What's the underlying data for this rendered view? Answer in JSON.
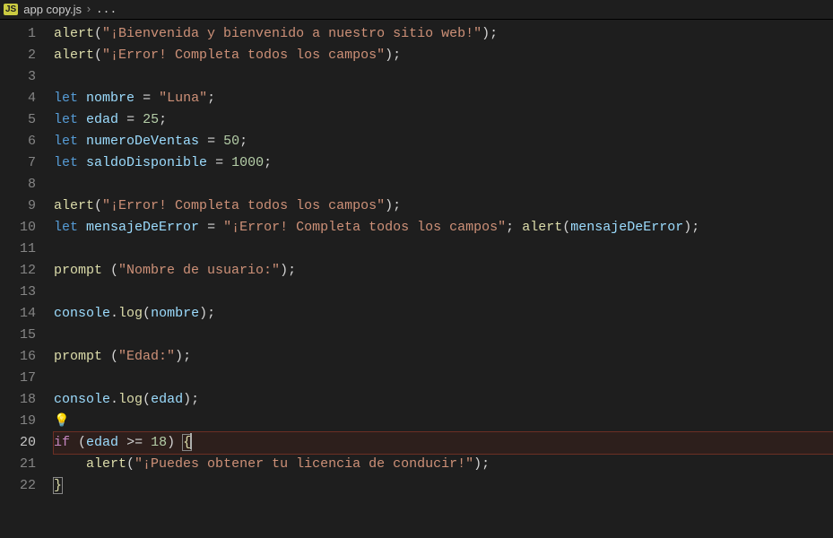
{
  "tab": {
    "icon_label": "JS",
    "filename": "app copy.js",
    "breadcrumb_tail": "..."
  },
  "editor": {
    "active_line": 20,
    "lightbulb_line": 19,
    "highlighted_line": 20,
    "lines": [
      {
        "n": 1,
        "tokens": [
          [
            "fn",
            "alert"
          ],
          [
            "punc",
            "("
          ],
          [
            "str",
            "\"¡Bienvenida y bienvenido a nuestro sitio web!\""
          ],
          [
            "punc",
            ")"
          ],
          [
            "punc",
            ";"
          ]
        ]
      },
      {
        "n": 2,
        "tokens": [
          [
            "fn",
            "alert"
          ],
          [
            "punc",
            "("
          ],
          [
            "str",
            "\"¡Error! Completa todos los campos\""
          ],
          [
            "punc",
            ")"
          ],
          [
            "punc",
            ";"
          ]
        ]
      },
      {
        "n": 3,
        "tokens": []
      },
      {
        "n": 4,
        "tokens": [
          [
            "kw",
            "let"
          ],
          [
            "punc",
            " "
          ],
          [
            "var",
            "nombre"
          ],
          [
            "punc",
            " "
          ],
          [
            "op",
            "="
          ],
          [
            "punc",
            " "
          ],
          [
            "str",
            "\"Luna\""
          ],
          [
            "punc",
            ";"
          ]
        ]
      },
      {
        "n": 5,
        "tokens": [
          [
            "kw",
            "let"
          ],
          [
            "punc",
            " "
          ],
          [
            "var",
            "edad"
          ],
          [
            "punc",
            " "
          ],
          [
            "op",
            "="
          ],
          [
            "punc",
            " "
          ],
          [
            "num",
            "25"
          ],
          [
            "punc",
            ";"
          ]
        ]
      },
      {
        "n": 6,
        "tokens": [
          [
            "kw",
            "let"
          ],
          [
            "punc",
            " "
          ],
          [
            "var",
            "numeroDeVentas"
          ],
          [
            "punc",
            " "
          ],
          [
            "op",
            "="
          ],
          [
            "punc",
            " "
          ],
          [
            "num",
            "50"
          ],
          [
            "punc",
            ";"
          ]
        ]
      },
      {
        "n": 7,
        "tokens": [
          [
            "kw",
            "let"
          ],
          [
            "punc",
            " "
          ],
          [
            "var",
            "saldoDisponible"
          ],
          [
            "punc",
            " "
          ],
          [
            "op",
            "="
          ],
          [
            "punc",
            " "
          ],
          [
            "num",
            "1000"
          ],
          [
            "punc",
            ";"
          ]
        ]
      },
      {
        "n": 8,
        "tokens": []
      },
      {
        "n": 9,
        "tokens": [
          [
            "fn",
            "alert"
          ],
          [
            "punc",
            "("
          ],
          [
            "str",
            "\"¡Error! Completa todos los campos\""
          ],
          [
            "punc",
            ")"
          ],
          [
            "punc",
            ";"
          ]
        ]
      },
      {
        "n": 10,
        "tokens": [
          [
            "kw",
            "let"
          ],
          [
            "punc",
            " "
          ],
          [
            "var",
            "mensajeDeError"
          ],
          [
            "punc",
            " "
          ],
          [
            "op",
            "="
          ],
          [
            "punc",
            " "
          ],
          [
            "str",
            "\"¡Error! Completa todos los campos\""
          ],
          [
            "punc",
            "; "
          ],
          [
            "fn",
            "alert"
          ],
          [
            "punc",
            "("
          ],
          [
            "var",
            "mensajeDeError"
          ],
          [
            "punc",
            ")"
          ],
          [
            "punc",
            ";"
          ]
        ]
      },
      {
        "n": 11,
        "tokens": []
      },
      {
        "n": 12,
        "tokens": [
          [
            "fn",
            "prompt"
          ],
          [
            "punc",
            " ("
          ],
          [
            "str",
            "\"Nombre de usuario:\""
          ],
          [
            "punc",
            ")"
          ],
          [
            "punc",
            ";"
          ]
        ]
      },
      {
        "n": 13,
        "tokens": []
      },
      {
        "n": 14,
        "tokens": [
          [
            "obj",
            "console"
          ],
          [
            "punc",
            "."
          ],
          [
            "fn",
            "log"
          ],
          [
            "punc",
            "("
          ],
          [
            "var",
            "nombre"
          ],
          [
            "punc",
            ")"
          ],
          [
            "punc",
            ";"
          ]
        ]
      },
      {
        "n": 15,
        "tokens": []
      },
      {
        "n": 16,
        "tokens": [
          [
            "fn",
            "prompt"
          ],
          [
            "punc",
            " ("
          ],
          [
            "str",
            "\"Edad:\""
          ],
          [
            "punc",
            ")"
          ],
          [
            "punc",
            ";"
          ]
        ]
      },
      {
        "n": 17,
        "tokens": []
      },
      {
        "n": 18,
        "tokens": [
          [
            "obj",
            "console"
          ],
          [
            "punc",
            "."
          ],
          [
            "fn",
            "log"
          ],
          [
            "punc",
            "("
          ],
          [
            "var",
            "edad"
          ],
          [
            "punc",
            ")"
          ],
          [
            "punc",
            ";"
          ]
        ]
      },
      {
        "n": 19,
        "tokens": []
      },
      {
        "n": 20,
        "tokens": [
          [
            "ctrl",
            "if"
          ],
          [
            "punc",
            " ("
          ],
          [
            "var",
            "edad"
          ],
          [
            "punc",
            " "
          ],
          [
            "op",
            ">="
          ],
          [
            "punc",
            " "
          ],
          [
            "num",
            "18"
          ],
          [
            "punc",
            ") "
          ],
          [
            "fn-brace",
            "{"
          ],
          [
            "cursor",
            ""
          ]
        ]
      },
      {
        "n": 21,
        "tokens": [
          [
            "punc",
            "    "
          ],
          [
            "fn",
            "alert"
          ],
          [
            "punc",
            "("
          ],
          [
            "str",
            "\"¡Puedes obtener tu licencia de conducir!\""
          ],
          [
            "punc",
            ")"
          ],
          [
            "punc",
            ";"
          ]
        ]
      },
      {
        "n": 22,
        "tokens": [
          [
            "fn-brace",
            "}"
          ]
        ]
      }
    ]
  }
}
